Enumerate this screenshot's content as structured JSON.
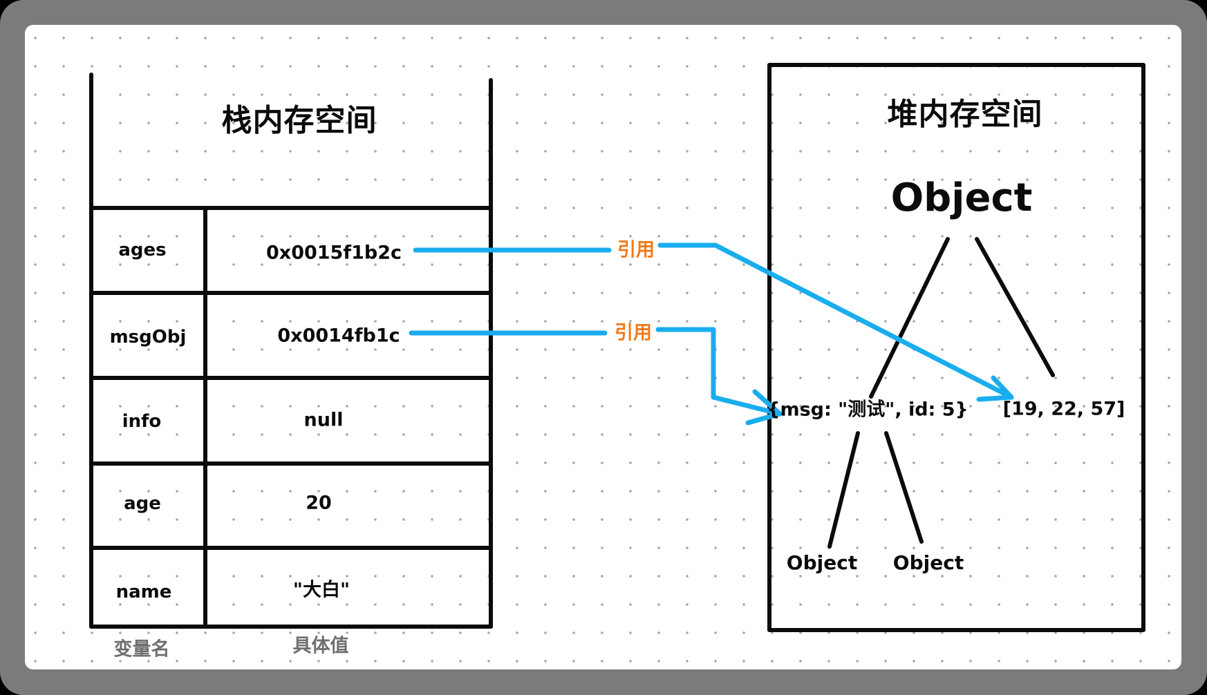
{
  "stack": {
    "title": "栈内存空间",
    "rows": [
      {
        "name": "ages",
        "value": "0x0015f1b2c"
      },
      {
        "name": "msgObj",
        "value": "0x0014fb1c"
      },
      {
        "name": "info",
        "value": "null"
      },
      {
        "name": "age",
        "value": "20"
      },
      {
        "name": "name",
        "value": "\"大白\""
      }
    ],
    "footer": {
      "name_label": "变量名",
      "value_label": "具体值"
    }
  },
  "references": [
    {
      "label": "引用",
      "from": "ages",
      "to": "array"
    },
    {
      "label": "引用",
      "from": "msgObj",
      "to": "msg-object"
    }
  ],
  "heap": {
    "title": "堆内存空间",
    "root": "Object",
    "children": {
      "msg_object": "{msg: \"测试\", id: 5}",
      "array": "[19, 22, 57]"
    },
    "grandchildren": [
      "Object",
      "Object"
    ]
  },
  "colors": {
    "reference_arrow": "#1aadee",
    "reference_label": "#f07a1a",
    "line": "#0b0b0b",
    "footer_text": "#6e6e6e",
    "grid_dot": "#a9a9a9"
  }
}
